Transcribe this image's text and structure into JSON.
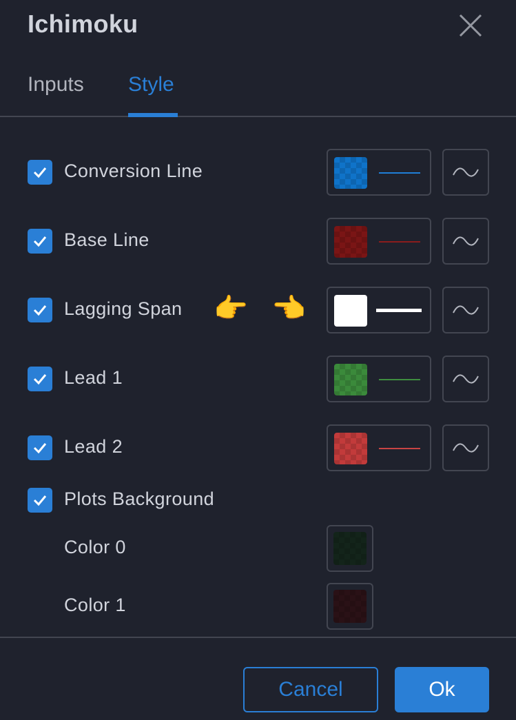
{
  "dialog": {
    "title": "Ichimoku"
  },
  "tabs": [
    {
      "label": "Inputs",
      "active": false
    },
    {
      "label": "Style",
      "active": true
    }
  ],
  "plots": [
    {
      "label": "Conversion Line",
      "checked": true,
      "color": "#0f73c9",
      "line_color": "#1f7fd8"
    },
    {
      "label": "Base Line",
      "checked": true,
      "color": "#7a1515",
      "line_color": "#8b1c1c"
    },
    {
      "label": "Lagging Span",
      "checked": true,
      "color": "#ffffff",
      "line_color": "#ffffff",
      "annotation": [
        "👉",
        "👈"
      ]
    },
    {
      "label": "Lead 1",
      "checked": true,
      "color": "#3b8a3b",
      "line_color": "#3f8f3f"
    },
    {
      "label": "Lead 2",
      "checked": true,
      "color": "#c23b3b",
      "line_color": "#c94444"
    }
  ],
  "background": {
    "label": "Plots Background",
    "checked": true,
    "colors": [
      {
        "label": "Color 0",
        "color": "#13241a"
      },
      {
        "label": "Color 1",
        "color": "#2a1116"
      }
    ]
  },
  "footer": {
    "cancel_label": "Cancel",
    "ok_label": "Ok"
  },
  "theme": {
    "accent": "#2a7fd6",
    "background": "#1f222d",
    "border": "#434651"
  }
}
